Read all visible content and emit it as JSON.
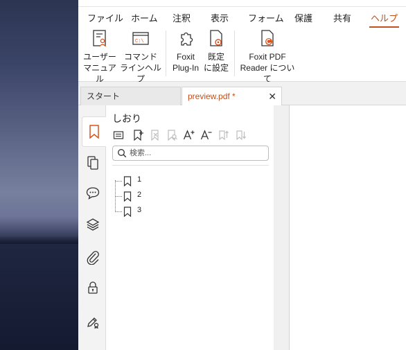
{
  "menu": {
    "items": [
      "ファイル",
      "ホーム",
      "注釈",
      "表示",
      "フォーム",
      "保護",
      "共有",
      "ヘルプ"
    ],
    "active": "ヘルプ"
  },
  "ribbon": {
    "buttons": [
      {
        "line1": "ユーザー",
        "line2": "マニュアル",
        "icon": "user-manual-icon"
      },
      {
        "line1": "コマンド",
        "line2": "ラインヘルプ",
        "icon": "command-line-icon"
      },
      {
        "line1": "Foxit",
        "line2": "Plug-In",
        "icon": "plugin-icon"
      },
      {
        "line1": "既定",
        "line2": "に設定",
        "icon": "set-default-icon"
      },
      {
        "line1": "Foxit PDF",
        "line2": "Reader について",
        "icon": "about-foxit-icon"
      }
    ]
  },
  "tabs": {
    "start": "スタート",
    "document": "preview.pdf *",
    "close_glyph": "✕"
  },
  "sidebar": {
    "buttons": [
      "bookmark-icon",
      "pages-icon",
      "comments-icon",
      "layers-icon",
      "attachments-icon",
      "security-icon",
      "signatures-icon"
    ],
    "active": "bookmark-icon"
  },
  "bookmarks_panel": {
    "title": "しおり",
    "search_placeholder": "検索...",
    "items": [
      {
        "label": "1"
      },
      {
        "label": "2"
      },
      {
        "label": "3"
      }
    ]
  },
  "colors": {
    "accent": "#c0501c",
    "foxit_red": "#d9531e"
  }
}
